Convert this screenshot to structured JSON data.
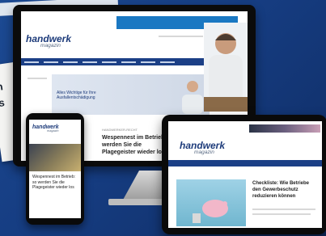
{
  "monitor": {
    "logo_main": "handwerk",
    "logo_sub": "magazin",
    "banner_text": "Alles Wichtige für Ihre Ausfallentschädigung",
    "article_kicker": "HANDWERKER-RECHT",
    "article_title": "Wespennest im Betrieb: werden Sie die Plagegeister wieder los"
  },
  "phone": {
    "logo_main": "handwerk",
    "logo_sub": "magazin",
    "article_title": "Wespennest im Betrieb: so werden Sie die Plagegeister wieder los"
  },
  "tablet": {
    "logo_main": "handwerk",
    "logo_sub": "magazin",
    "article_title": "Checkliste: Wie Betriebe den Gewerbeschutz reduzieren können"
  },
  "colors": {
    "background": "#17397a",
    "nav": "#1b3f86",
    "brand": "#1d3b7a"
  }
}
